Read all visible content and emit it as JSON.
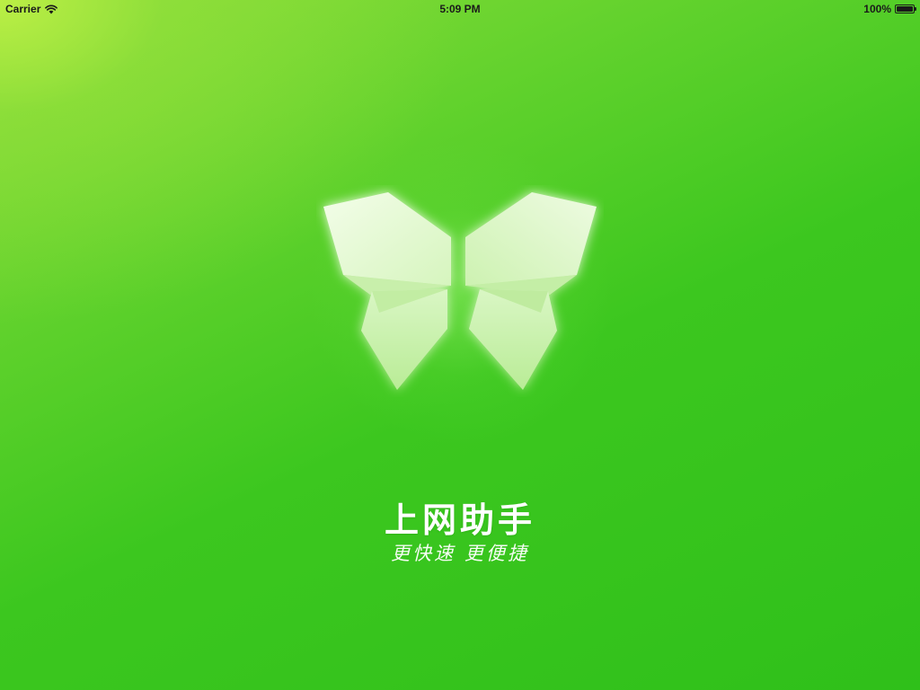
{
  "status_bar": {
    "carrier": "Carrier",
    "time": "5:09 PM",
    "battery": "100%",
    "battery_level": 1.0,
    "icons": [
      "wifi-icon",
      "battery-icon"
    ]
  },
  "splash": {
    "logo_icon": "butterfly-logo-icon",
    "title": "上网助手",
    "slogan": "更快速  更便捷"
  },
  "colors": {
    "background_primary": "#3cc71f",
    "background_highlight": "#b6ee46",
    "text": "#ffffff",
    "status_text": "#1a1a1a"
  }
}
